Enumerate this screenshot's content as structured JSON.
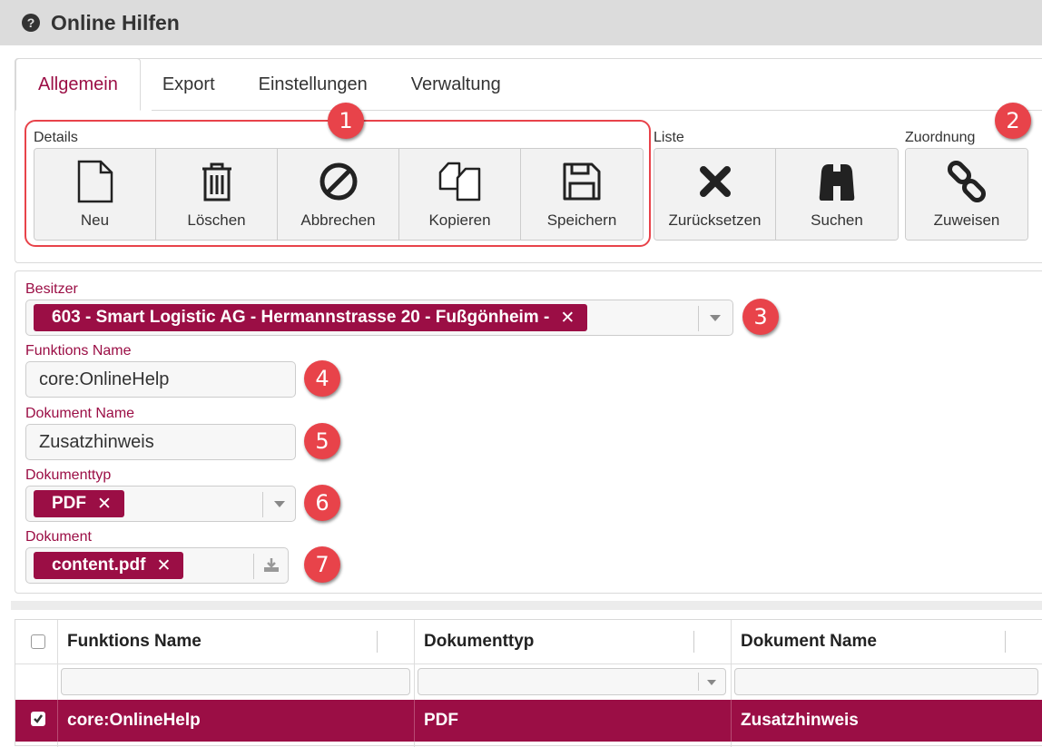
{
  "header": {
    "title": "Online Hilfen",
    "icon": "help-circle-icon"
  },
  "tabs": [
    {
      "label": "Allgemein",
      "active": true
    },
    {
      "label": "Export",
      "active": false
    },
    {
      "label": "Einstellungen",
      "active": false
    },
    {
      "label": "Verwaltung",
      "active": false
    }
  ],
  "toolbar": {
    "details_label": "Details",
    "liste_label": "Liste",
    "zuordnung_label": "Zuordnung",
    "neu": "Neu",
    "loeschen": "Löschen",
    "abbrechen": "Abbrechen",
    "kopieren": "Kopieren",
    "speichern": "Speichern",
    "zuruecksetzen": "Zurücksetzen",
    "suchen": "Suchen",
    "zuweisen": "Zuweisen"
  },
  "callouts": [
    "1",
    "2",
    "3",
    "4",
    "5",
    "6",
    "7"
  ],
  "form": {
    "besitzer_label": "Besitzer",
    "besitzer_value": "603 - Smart Logistic AG - Hermannstrasse 20 - Fußgönheim -",
    "funktionsname_label": "Funktions Name",
    "funktionsname_value": "core:OnlineHelp",
    "dokumentname_label": "Dokument Name",
    "dokumentname_value": "Zusatzhinweis",
    "dokumenttyp_label": "Dokumenttyp",
    "dokumenttyp_value": "PDF",
    "dokument_label": "Dokument",
    "dokument_value": "content.pdf",
    "chip_remove": "✕"
  },
  "grid": {
    "columns": [
      "Funktions Name",
      "Dokumenttyp",
      "Dokument Name"
    ],
    "rows": [
      {
        "selected": true,
        "funktionsname": "core:OnlineHelp",
        "dokumenttyp": "PDF",
        "dokumentname": "Zusatzhinweis"
      }
    ]
  },
  "colors": {
    "accent": "#9b0e45",
    "callout": "#e8434a",
    "header_bg": "#dcdcdc"
  }
}
